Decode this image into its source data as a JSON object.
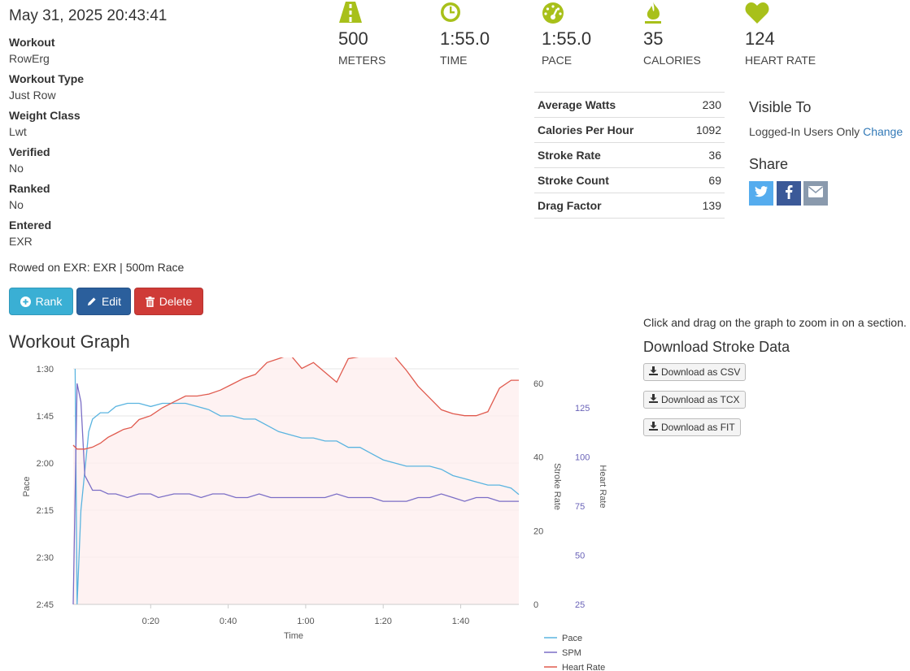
{
  "header": {
    "datetime": "May 31, 2025 20:43:41"
  },
  "details": [
    {
      "label": "Workout",
      "value": "RowErg"
    },
    {
      "label": "Workout Type",
      "value": "Just Row"
    },
    {
      "label": "Weight Class",
      "value": "Lwt"
    },
    {
      "label": "Verified",
      "value": "No"
    },
    {
      "label": "Ranked",
      "value": "No"
    },
    {
      "label": "Entered",
      "value": "EXR"
    }
  ],
  "rowed_on": "Rowed on EXR: EXR | 500m Race",
  "actions": {
    "rank": "Rank",
    "edit": "Edit",
    "delete": "Delete"
  },
  "stats": [
    {
      "icon": "road-icon",
      "value": "500",
      "label": "METERS"
    },
    {
      "icon": "clock-icon",
      "value": "1:55.0",
      "label": "TIME"
    },
    {
      "icon": "speedometer-icon",
      "value": "1:55.0",
      "label": "PACE"
    },
    {
      "icon": "flame-icon",
      "value": "35",
      "label": "CALORIES"
    },
    {
      "icon": "heart-icon",
      "value": "124",
      "label": "HEART RATE"
    }
  ],
  "accent_color": "#a8c01a",
  "metrics": [
    {
      "name": "Average Watts",
      "value": "230"
    },
    {
      "name": "Calories Per Hour",
      "value": "1092"
    },
    {
      "name": "Stroke Rate",
      "value": "36"
    },
    {
      "name": "Stroke Count",
      "value": "69"
    },
    {
      "name": "Drag Factor",
      "value": "139"
    }
  ],
  "visibility": {
    "title": "Visible To",
    "text": "Logged-In Users Only",
    "change": "Change"
  },
  "share": {
    "title": "Share",
    "buttons": [
      "twitter-icon",
      "facebook-icon",
      "email-icon"
    ]
  },
  "graph": {
    "title": "Workout Graph",
    "zoom_note": "Click and drag on the graph to zoom in on a section.",
    "download_title": "Download Stroke Data",
    "downloads": [
      "Download as CSV",
      "Download as TCX",
      "Download as FIT"
    ]
  },
  "chart_data": {
    "type": "line",
    "xlabel": "Time",
    "x_ticks": [
      "0:20",
      "0:40",
      "1:00",
      "1:20",
      "1:40"
    ],
    "pace_axis": {
      "label": "Pace",
      "ticks": [
        "1:30",
        "1:45",
        "2:00",
        "2:15",
        "2:30",
        "2:45"
      ]
    },
    "stroke_rate_axis": {
      "label": "Stroke Rate",
      "ticks": [
        "60",
        "40",
        "20",
        "0"
      ]
    },
    "heart_rate_axis": {
      "label": "Heart Rate",
      "ticks": [
        "125",
        "100",
        "75",
        "50",
        "25"
      ]
    },
    "series": [
      {
        "name": "Pace",
        "color": "#5ab4e0",
        "unit": "seconds per 500m",
        "x": [
          0.5,
          1,
          2,
          4,
          5,
          7,
          9,
          11,
          14,
          17,
          20,
          23,
          26,
          29,
          32,
          35,
          38,
          41,
          44,
          47,
          50,
          53,
          56,
          59,
          62,
          65,
          68,
          71,
          74,
          77,
          80,
          83,
          86,
          89,
          92,
          95,
          98,
          101,
          104,
          107,
          110,
          113,
          115
        ],
        "y": [
          90,
          165,
          135,
          110,
          106,
          104,
          104,
          102,
          101,
          101,
          102,
          101,
          101,
          101,
          102,
          103,
          105,
          105,
          106,
          106,
          108,
          110,
          111,
          112,
          112,
          113,
          113,
          115,
          115,
          117,
          119,
          120,
          121,
          121,
          121,
          122,
          124,
          125,
          126,
          127,
          127,
          128,
          130
        ]
      },
      {
        "name": "SPM",
        "color": "#7b6ec6",
        "unit": "strokes per minute",
        "x": [
          0,
          1,
          2,
          3,
          4,
          5,
          7,
          9,
          11,
          14,
          17,
          20,
          22,
          26,
          30,
          33,
          36,
          39,
          42,
          45,
          48,
          51,
          54,
          57,
          60,
          62,
          65,
          68,
          71,
          74,
          77,
          80,
          83,
          86,
          89,
          92,
          95,
          98,
          101,
          104,
          107,
          110,
          112,
          115
        ],
        "y": [
          0,
          60,
          55,
          35,
          33,
          31,
          31,
          30,
          30,
          29,
          30,
          30,
          29,
          30,
          30,
          29,
          30,
          30,
          29,
          29,
          30,
          29,
          29,
          29,
          29,
          29,
          29,
          30,
          29,
          29,
          29,
          28,
          28,
          28,
          29,
          29,
          30,
          29,
          28,
          29,
          29,
          28,
          28,
          28
        ]
      },
      {
        "name": "Heart Rate",
        "color": "#e05a4e",
        "unit": "bpm",
        "x": [
          0,
          1,
          3,
          5,
          7,
          9,
          11,
          13,
          15,
          17,
          20,
          23,
          26,
          29,
          32,
          35,
          38,
          41,
          44,
          47,
          50,
          53,
          56,
          59,
          62,
          65,
          68,
          71,
          74,
          77,
          80,
          83,
          86,
          89,
          92,
          95,
          98,
          101,
          104,
          107,
          110,
          113,
          115
        ],
        "y": [
          106,
          104,
          104,
          105,
          107,
          110,
          112,
          114,
          115,
          119,
          121,
          125,
          128,
          131,
          131,
          132,
          134,
          137,
          140,
          142,
          148,
          150,
          152,
          145,
          148,
          143,
          138,
          150,
          151,
          153,
          155,
          151,
          144,
          136,
          130,
          124,
          122,
          121,
          121,
          123,
          135,
          139,
          139
        ]
      }
    ]
  }
}
